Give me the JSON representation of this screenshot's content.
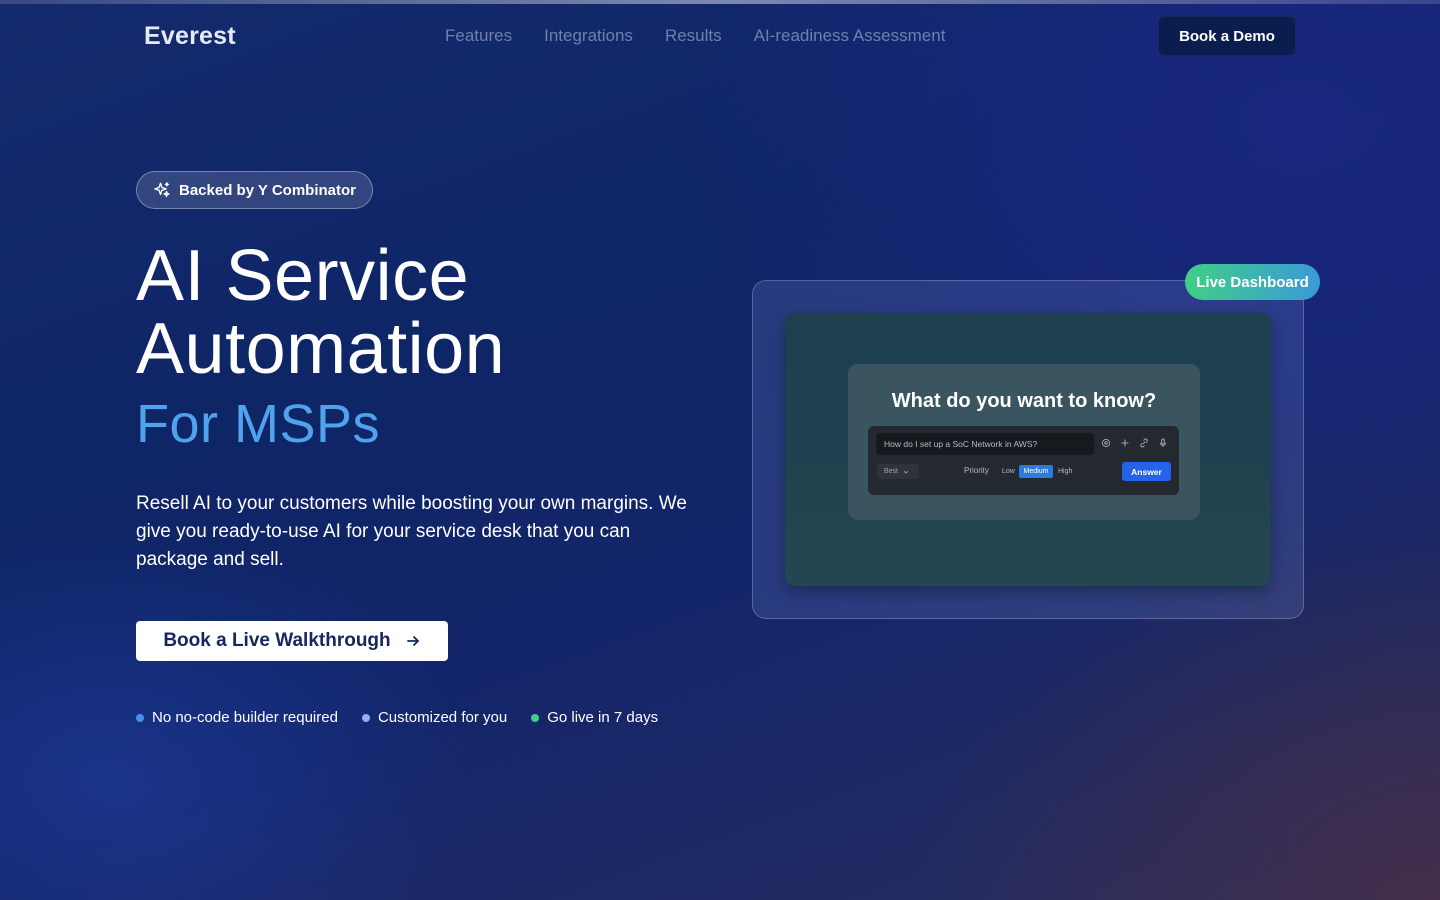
{
  "brand": {
    "name": "Everest"
  },
  "nav": {
    "items": [
      {
        "label": "Features"
      },
      {
        "label": "Integrations"
      },
      {
        "label": "Results"
      },
      {
        "label": "AI-readiness Assessment"
      }
    ],
    "demo_button": "Book a Demo"
  },
  "hero": {
    "badge": "Backed by Y Combinator",
    "title_line1": "AI Service",
    "title_line2": "Automation",
    "subtitle": "For MSPs",
    "description": "Resell AI to your customers while boosting your own margins. We give you ready-to-use AI for your service desk that you can package and sell.",
    "cta": "Book a Live Walkthrough",
    "points": [
      {
        "label": "No no-code builder required",
        "color": "#4a8fe8"
      },
      {
        "label": "Customized for you",
        "color": "#8fb2ec"
      },
      {
        "label": "Go live in 7 days",
        "color": "#3fcf86"
      }
    ]
  },
  "dashboard": {
    "badge": "Live Dashboard",
    "question_title": "What do you want to know?",
    "input_value": "How do I set up a SoC Network in AWS?",
    "mode": "Best",
    "priority_label": "Priority",
    "priority_options": [
      "Low",
      "Medium",
      "High"
    ],
    "priority_selected": "Medium",
    "answer_button": "Answer"
  },
  "colors": {
    "accent_blue": "#4fa3ec",
    "badge_gradient_start": "#3fcf86",
    "badge_gradient_end": "#3a9ad8",
    "answer_button": "#2563eb"
  }
}
